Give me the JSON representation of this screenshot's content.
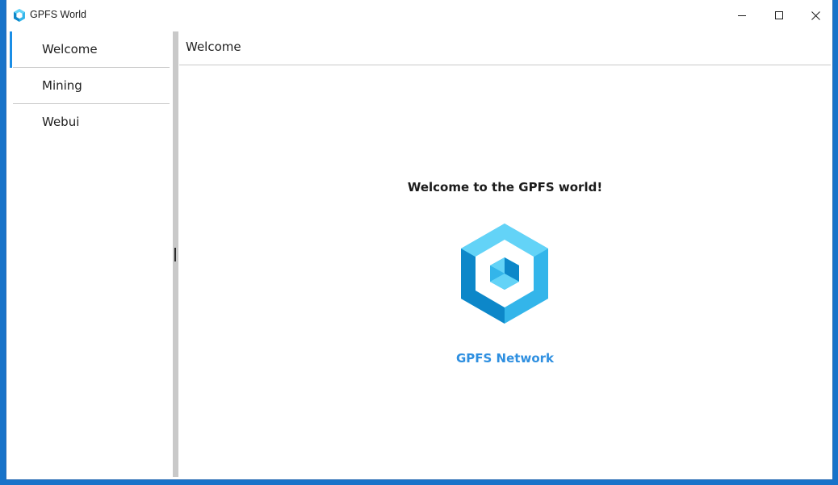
{
  "window": {
    "title": "GPFS World",
    "icons": {
      "app": "gpfs-cube-icon",
      "minimize": "minimize-icon",
      "maximize": "maximize-icon",
      "close": "close-icon"
    }
  },
  "sidebar": {
    "items": [
      {
        "label": "Welcome",
        "active": true
      },
      {
        "label": "Mining",
        "active": false
      },
      {
        "label": "Webui",
        "active": false
      }
    ]
  },
  "content": {
    "header": "Welcome",
    "welcome_text": "Welcome to the GPFS world!",
    "logo_icon": "gpfs-hexagon-cube-logo",
    "link_text": "GPFS Network"
  },
  "colors": {
    "accent": "#1b8ee6",
    "link": "#2e8fe0",
    "logo_light": "#63d3f7",
    "logo_mid": "#33b5ea",
    "logo_dark": "#0d87c9",
    "desktop": "#1873c9"
  }
}
